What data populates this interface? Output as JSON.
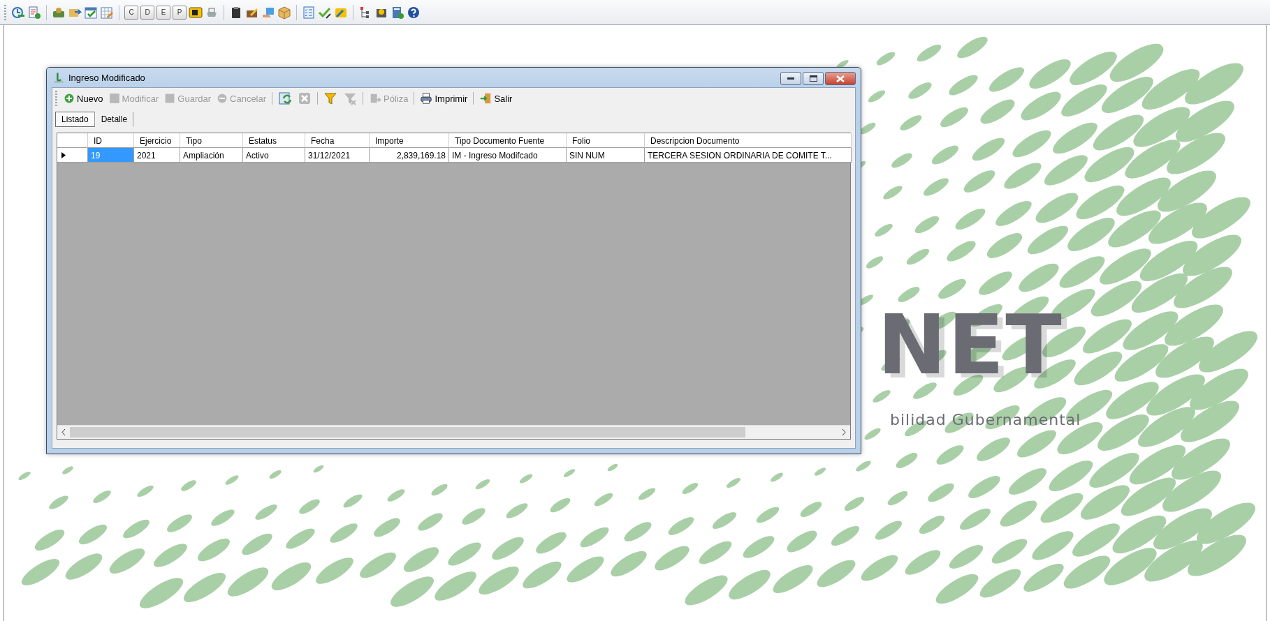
{
  "app_toolbar": {
    "key_buttons": [
      "C",
      "D",
      "E",
      "P"
    ]
  },
  "background_logo": {
    "wordmark": "NET",
    "tagline": "bilidad Gubernamental"
  },
  "window": {
    "title": "Ingreso Modificado",
    "toolbar": [
      {
        "kind": "add",
        "label": "Nuevo",
        "disabled": false
      },
      {
        "kind": "edit",
        "label": "Modificar",
        "disabled": true
      },
      {
        "kind": "save",
        "label": "Guardar",
        "disabled": true
      },
      {
        "kind": "cancel",
        "label": "Cancelar",
        "disabled": true
      },
      {
        "kind": "separator"
      },
      {
        "kind": "refresh",
        "disabled": false
      },
      {
        "kind": "delete",
        "disabled": true
      },
      {
        "kind": "separator"
      },
      {
        "kind": "filter",
        "disabled": false
      },
      {
        "kind": "clear-filter",
        "disabled": true
      },
      {
        "kind": "separator"
      },
      {
        "kind": "policy",
        "label": "Póliza",
        "disabled": true
      },
      {
        "kind": "separator"
      },
      {
        "kind": "print",
        "label": "Imprimir",
        "disabled": false
      },
      {
        "kind": "separator"
      },
      {
        "kind": "exit",
        "label": "Salir",
        "disabled": false
      }
    ],
    "tabs": [
      {
        "label": "Listado",
        "selected": true
      },
      {
        "label": "Detalle",
        "selected": false
      }
    ],
    "table": {
      "columns": [
        {
          "label": "ID",
          "kind": "text"
        },
        {
          "label": "Ejercicio",
          "kind": "text"
        },
        {
          "label": "Tipo",
          "kind": "text"
        },
        {
          "label": "Estatus",
          "kind": "text"
        },
        {
          "label": "Fecha",
          "kind": "text"
        },
        {
          "label": "Importe",
          "kind": "number"
        },
        {
          "label": "Tipo Documento Fuente",
          "kind": "text"
        },
        {
          "label": "Folio",
          "kind": "text"
        },
        {
          "label": "Descripcion Documento",
          "kind": "text"
        }
      ],
      "rows": [
        {
          "current": true,
          "cells": [
            {
              "text": "19",
              "selected": true
            },
            {
              "text": "2021",
              "selected": false
            },
            {
              "text": "Ampliación",
              "selected": false
            },
            {
              "text": "Activo",
              "selected": false
            },
            {
              "text": "31/12/2021",
              "selected": false
            },
            {
              "text": "2,839,169.18",
              "selected": false
            },
            {
              "text": "IM - Ingreso Modifcado",
              "selected": false
            },
            {
              "text": "SIN NUM",
              "selected": false
            },
            {
              "text": "TERCERA SESION ORDINARIA DE COMITE T...",
              "selected": false
            }
          ]
        }
      ]
    }
  }
}
